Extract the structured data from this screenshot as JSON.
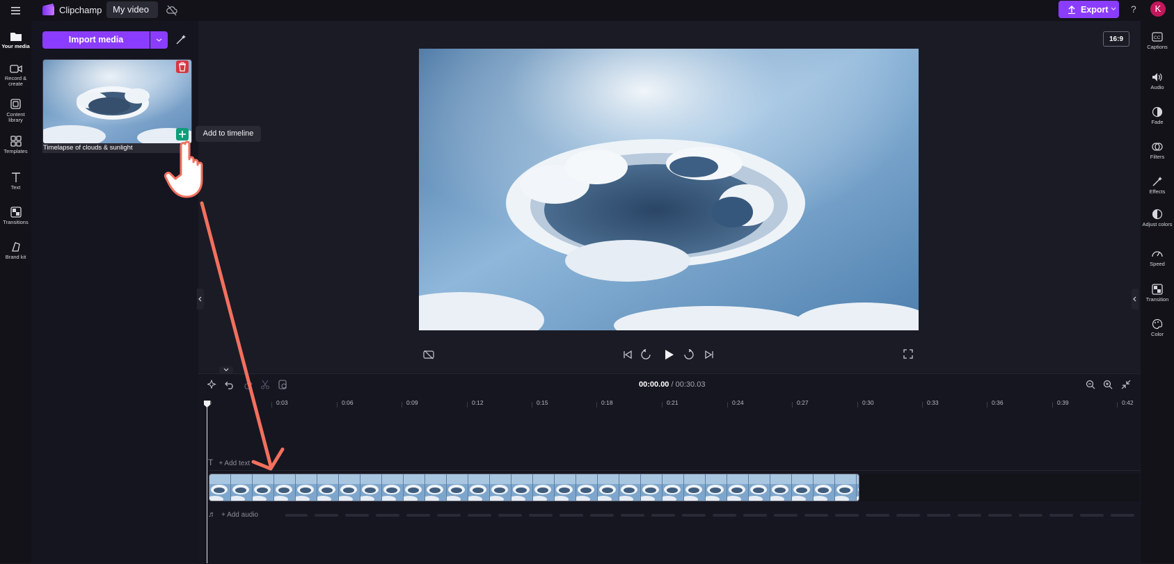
{
  "app": {
    "name": "Clipchamp",
    "project_title": "My video"
  },
  "header": {
    "export_label": "Export",
    "avatar_initial": "K",
    "help_label": "?"
  },
  "leftnav": {
    "items": [
      {
        "label": "Your media",
        "icon": "folder-icon"
      },
      {
        "label": "Record & create",
        "icon": "video-camera-icon"
      },
      {
        "label": "Content library",
        "icon": "library-icon"
      },
      {
        "label": "Templates",
        "icon": "templates-icon"
      },
      {
        "label": "Text",
        "icon": "text-icon"
      },
      {
        "label": "Transitions",
        "icon": "transitions-icon"
      },
      {
        "label": "Brand kit",
        "icon": "brand-kit-icon"
      }
    ]
  },
  "media": {
    "import_label": "Import media",
    "item_caption": "Timelapse of clouds & sunlight",
    "tooltip": "Add to timeline"
  },
  "preview": {
    "aspect_ratio": "16:9"
  },
  "rightpanel": {
    "items": [
      {
        "label": "Captions",
        "icon": "captions-icon"
      },
      {
        "label": "Audio",
        "icon": "speaker-icon"
      },
      {
        "label": "Fade",
        "icon": "fade-icon"
      },
      {
        "label": "Filters",
        "icon": "filters-icon"
      },
      {
        "label": "Effects",
        "icon": "effects-icon"
      },
      {
        "label": "Adjust colors",
        "icon": "adjust-colors-icon"
      },
      {
        "label": "Speed",
        "icon": "speed-icon"
      },
      {
        "label": "Transition",
        "icon": "transition-icon"
      },
      {
        "label": "Color",
        "icon": "palette-icon"
      }
    ]
  },
  "timeline": {
    "current_time": "00:00.00",
    "total_time": "/ 00:30.03",
    "ticks": [
      "0",
      "0:03",
      "0:06",
      "0:09",
      "0:12",
      "0:15",
      "0:18",
      "0:21",
      "0:24",
      "0:27",
      "0:30",
      "0:33",
      "0:36",
      "0:39",
      "0:42"
    ],
    "add_text_label": "+ Add text",
    "add_audio_label": "+ Add audio"
  },
  "colors": {
    "accent": "#8b3dff",
    "add_green": "#0f9d7a",
    "delete_red": "#d93640",
    "annotation": "#f2705e"
  }
}
